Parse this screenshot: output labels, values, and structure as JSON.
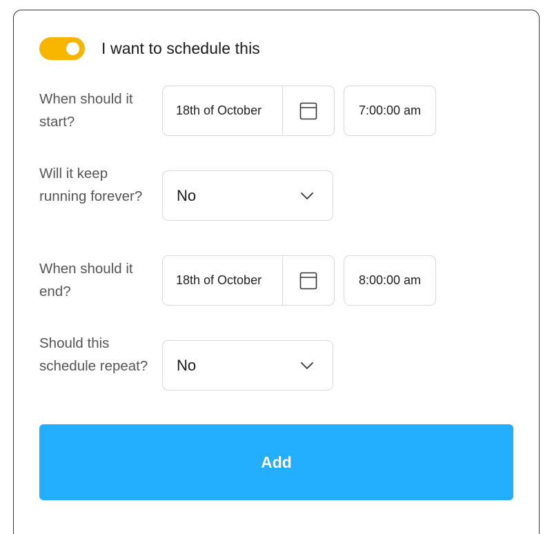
{
  "schedule_toggle": {
    "label": "I want to schedule this",
    "on": true,
    "color": "#f7b500"
  },
  "start": {
    "label": "When should it start?",
    "date": "18th of October",
    "time": "7:00:00 am"
  },
  "forever": {
    "label": "Will it keep running forever?",
    "value": "No"
  },
  "end": {
    "label": "When should it end?",
    "date": "18th of October",
    "time": "8:00:00 am"
  },
  "repeat": {
    "label": "Should this schedule repeat?",
    "value": "No"
  },
  "add_button": {
    "label": "Add",
    "color": "#22aefc"
  },
  "icons": {
    "calendar": "calendar-icon",
    "dropdown": "chevron-down-icon"
  }
}
